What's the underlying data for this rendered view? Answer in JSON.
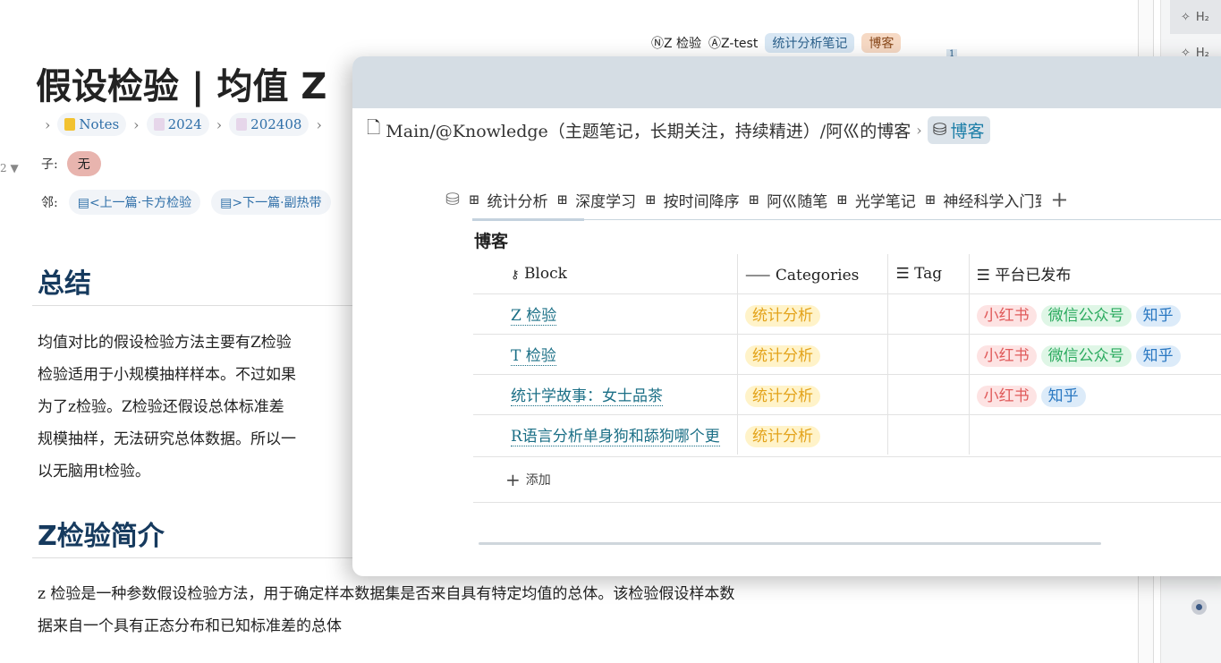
{
  "doc": {
    "title": "假设检验 | 均值 Z",
    "breadcrumb": [
      "Notes",
      "2024",
      "202408"
    ],
    "children_label": "子:",
    "children_value": "无",
    "neighbors_label": "邻:",
    "prev": "<上一篇·卡方检验",
    "next": ">下一篇·副热带",
    "fold_num": "2",
    "tags": {
      "n": "Z 检验",
      "a": "Z-test",
      "tag1": "统计分析笔记",
      "tag2": "博客",
      "badge": "1"
    },
    "h_summary": "总结",
    "summary_lines": [
      "均值对比的假设检验方法主要有Z检验",
      "检验适用于小规模抽样样本。不过如果",
      "为了z检验。Z检验还假设总体标准差",
      "规模抽样，无法研究总体数据。所以一",
      "以无脑用t检验。"
    ],
    "h_intro": "Z检验简介",
    "intro_lines": [
      "z 检验是一种参数假设检验方法，用于确定样本数据集是否来自具有特定均值的总体。该检验假设样本数",
      "据来自一个具有正态分布和已知标准差的总体"
    ]
  },
  "outline": {
    "items": [
      "H₂",
      "H₂"
    ]
  },
  "popup": {
    "path": "Main/@Knowledge（主题笔记，长期关注，持续精进）/阿巛的博客",
    "db_name": "博客",
    "tabs": [
      "统计分析",
      "深度学习",
      "按时间降序",
      "阿巛随笔",
      "光学笔记",
      "神经科学入门到"
    ],
    "add_tab": "+",
    "table_title": "博客",
    "columns": [
      "Block",
      "Categories",
      "Tag",
      "平台已发布"
    ],
    "rows": [
      {
        "block": "Z 检验",
        "category": "统计分析",
        "tag": "",
        "platforms": [
          "小红书",
          "微信公众号",
          "知乎"
        ]
      },
      {
        "block": "T 检验",
        "category": "统计分析",
        "tag": "",
        "platforms": [
          "小红书",
          "微信公众号",
          "知乎"
        ]
      },
      {
        "block": "统计学故事：女士品茶",
        "category": "统计分析",
        "tag": "",
        "platforms": [
          "小红书",
          "知乎"
        ]
      },
      {
        "block": "R语言分析单身狗和舔狗哪个更",
        "category": "统计分析",
        "tag": "",
        "platforms": []
      }
    ],
    "add_label": "添加"
  },
  "colors": {
    "heading": "#163a5e",
    "link": "#1b6f86",
    "category": "#e3a31b",
    "xiaohongshu": "#e05a5a",
    "wechat": "#2aaa5e",
    "zhihu": "#2a78c2"
  }
}
